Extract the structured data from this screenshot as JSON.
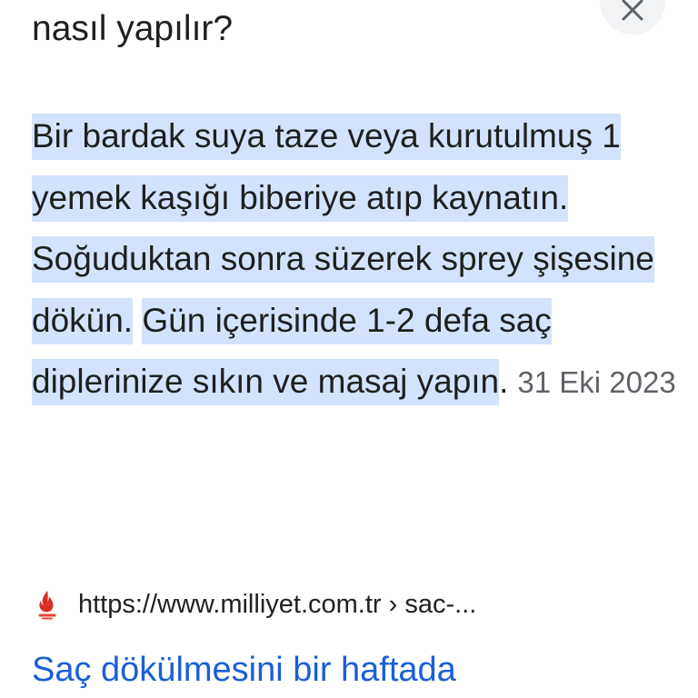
{
  "question": {
    "text_tail": "nasıl yapılır?"
  },
  "close_button": {
    "icon": "close-icon"
  },
  "snippet": {
    "part1": "Bir bardak suya taze veya kurutulmuş 1 yemek kaşığı biberiye atıp kaynatın. Soğuduktan sonra süzerek sprey şişesine dökün.",
    "part2": "Gün içerisinde 1-2 defa saç diplerinize sıkın ve masaj yapın",
    "end_punct": ".",
    "date": "31 Eki 2023"
  },
  "source": {
    "favicon": "milliyet-flame-icon",
    "url": "https://www.milliyet.com.tr › sac-..."
  },
  "result": {
    "title": "Saç dökülmesini bir haftada"
  },
  "colors": {
    "highlight": "#d3e3fd",
    "link": "#1a5fd6",
    "text": "#1f1f1f",
    "muted": "#5f6368",
    "favicon": "#d93025"
  }
}
